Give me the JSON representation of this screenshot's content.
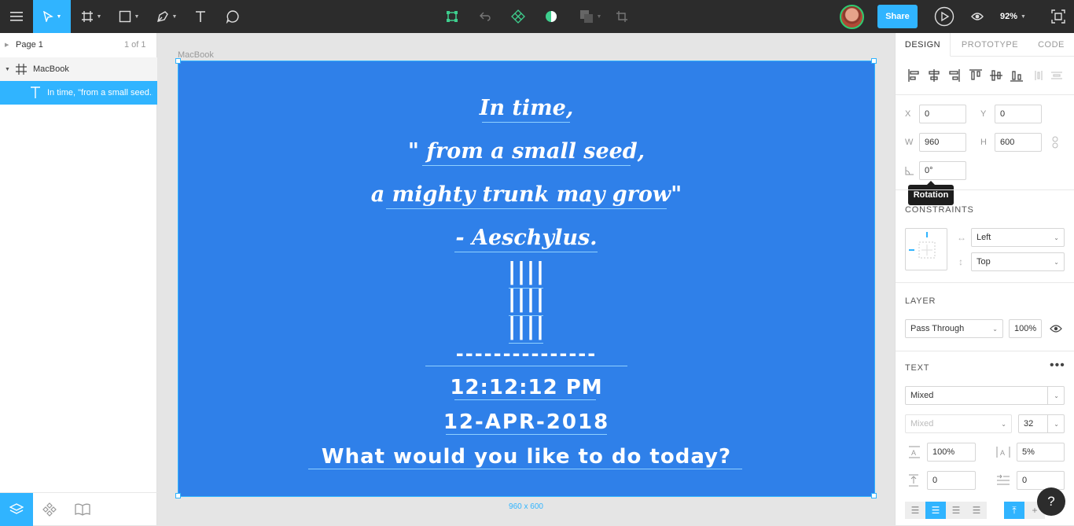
{
  "toolbar": {
    "share_label": "Share",
    "zoom_label": "92%",
    "icons": [
      "menu-icon",
      "move-tool-icon",
      "frame-tool-icon",
      "shape-tool-icon",
      "pen-tool-icon",
      "text-tool-icon",
      "comment-tool-icon",
      "component-icon",
      "undo-icon",
      "instance-icon",
      "contrast-icon",
      "boolean-icon",
      "crop-icon",
      "play-icon",
      "view-icon",
      "fullscreen-icon"
    ]
  },
  "layers": {
    "page_name": "Page 1",
    "page_count": "1 of 1",
    "frame_name": "MacBook",
    "text_layer": "In time, \"from a small seed..."
  },
  "canvas": {
    "frame_label": "MacBook",
    "size_label": "960 x 600",
    "quote_lines": [
      "In time,",
      "\" from a small seed,",
      "a mighty trunk may grow\"",
      "- Aeschylus."
    ],
    "pipes": "||||",
    "dashes": "---------------",
    "time": "12:12:12 PM",
    "date": "12-APR-2018",
    "prompt": "What would you like to do today?"
  },
  "design_panel": {
    "tabs": [
      "DESIGN",
      "PROTOTYPE",
      "CODE"
    ],
    "x_label": "X",
    "x_value": "0",
    "y_label": "Y",
    "y_value": "0",
    "w_label": "W",
    "w_value": "960",
    "h_label": "H",
    "h_value": "600",
    "rotation_value": "0°",
    "tooltip": "Rotation",
    "constraints_title": "CONSTRAINTS",
    "constraint_h": "Left",
    "constraint_v": "Top",
    "layer_title": "LAYER",
    "blend_mode": "Pass Through",
    "opacity": "100%",
    "text_title": "TEXT",
    "font_family": "Mixed",
    "font_weight": "Mixed",
    "font_size": "32",
    "line_height": "100%",
    "letter_spacing": "5%",
    "paragraph_spacing": "0",
    "paragraph_indent": "0",
    "help_label": "?"
  },
  "colors": {
    "accent": "#30b4ff",
    "frame_fill": "#2f80e9",
    "toolbar_bg": "#2c2c2c"
  }
}
